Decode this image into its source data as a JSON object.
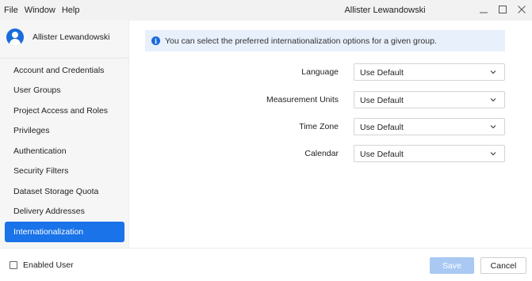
{
  "menu": [
    "File",
    "Window",
    "Help"
  ],
  "window_title": "Allister Lewandowski",
  "window_controls": {
    "minimize_icon": "minimize-icon",
    "maximize_icon": "maximize-icon",
    "close_icon": "close-icon"
  },
  "sidebar": {
    "user_name": "Allister Lewandowski",
    "items": [
      {
        "label": "Account and Credentials",
        "active": false
      },
      {
        "label": "User Groups",
        "active": false
      },
      {
        "label": "Project Access and Roles",
        "active": false
      },
      {
        "label": "Privileges",
        "active": false
      },
      {
        "label": "Authentication",
        "active": false
      },
      {
        "label": "Security Filters",
        "active": false
      },
      {
        "label": "Dataset Storage Quota",
        "active": false
      },
      {
        "label": "Delivery Addresses",
        "active": false
      },
      {
        "label": "Internationalization",
        "active": true
      }
    ]
  },
  "main": {
    "info_text": "You can select the preferred internationalization options for a given group.",
    "fields": [
      {
        "label": "Language",
        "value": "Use Default"
      },
      {
        "label": "Measurement Units",
        "value": "Use Default"
      },
      {
        "label": "Time Zone",
        "value": "Use Default"
      },
      {
        "label": "Calendar",
        "value": "Use Default"
      }
    ]
  },
  "footer": {
    "enabled_label": "Enabled User",
    "enabled_checked": false,
    "save_label": "Save",
    "cancel_label": "Cancel"
  },
  "colors": {
    "accent": "#1a73e8",
    "save_disabled": "#a9c9f3",
    "banner_bg": "#e8f0fb"
  }
}
